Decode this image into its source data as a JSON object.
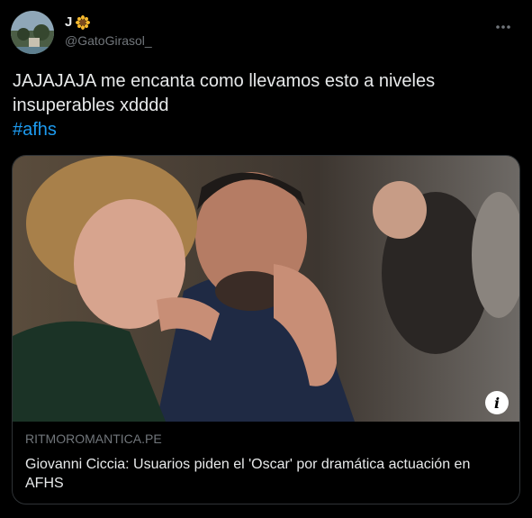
{
  "user": {
    "display_name": "J",
    "handle": "@GatoGirasol_",
    "name_emoji": "sunflower-emoji"
  },
  "tweet": {
    "text": "JAJAJAJA me encanta como llevamos esto a niveles insuperables xdddd",
    "hashtag": "#afhs"
  },
  "card": {
    "domain": "RITMOROMANTICA.PE",
    "title": "Giovanni Ciccia: Usuarios piden el 'Oscar' por dramática actuación en AFHS",
    "info_label": "i"
  },
  "colors": {
    "background": "#000000",
    "text": "#e7e9ea",
    "secondary_text": "#71767b",
    "link": "#1d9bf0",
    "border": "#2f3336"
  },
  "icons": {
    "more": "more-horizontal-icon",
    "info": "info-icon"
  }
}
